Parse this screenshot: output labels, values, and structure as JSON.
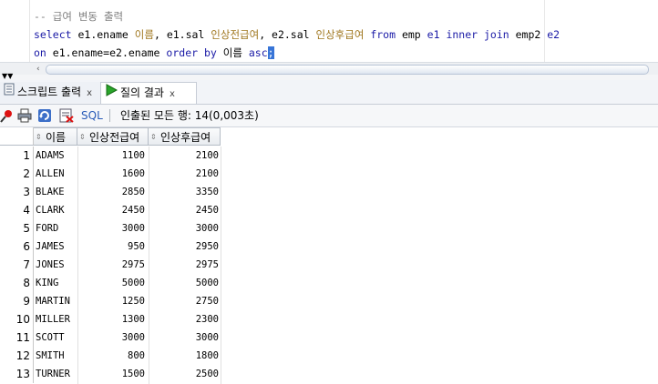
{
  "editor": {
    "lines": [
      {
        "comment": "-- 급여 변동 출력"
      },
      {
        "parts": [
          "select",
          " e1.ename ",
          "이름",
          ", e1.sal ",
          "인상전급여",
          ", e2.sal ",
          "인상후급여",
          " from",
          " emp ",
          "e1",
          " inner",
          " join",
          " emp2 ",
          "e2"
        ]
      },
      {
        "parts": [
          "on",
          " e1.ename=e2.ename ",
          "order",
          " by",
          " 이름 ",
          "asc",
          ";"
        ]
      }
    ]
  },
  "tabs": [
    {
      "label": "스크립트 출력",
      "close": "x",
      "icon": "script-output-icon"
    },
    {
      "label": "질의 결과",
      "close": "x",
      "icon": "run-query-icon"
    }
  ],
  "toolbar": {
    "sql_label": "SQL",
    "status": "인출된 모든 행: 14(0,003초)",
    "icons": [
      "pin-icon",
      "print-icon",
      "refresh-icon",
      "export-icon"
    ]
  },
  "grid": {
    "columns": [
      "이름",
      "인상전급여",
      "인상후급여"
    ],
    "rows": [
      {
        "n": "1",
        "name": "ADAMS",
        "before": "1100",
        "after": "2100"
      },
      {
        "n": "2",
        "name": "ALLEN",
        "before": "1600",
        "after": "2100"
      },
      {
        "n": "3",
        "name": "BLAKE",
        "before": "2850",
        "after": "3350"
      },
      {
        "n": "4",
        "name": "CLARK",
        "before": "2450",
        "after": "2450"
      },
      {
        "n": "5",
        "name": "FORD",
        "before": "3000",
        "after": "3000"
      },
      {
        "n": "6",
        "name": "JAMES",
        "before": "950",
        "after": "2950"
      },
      {
        "n": "7",
        "name": "JONES",
        "before": "2975",
        "after": "2975"
      },
      {
        "n": "8",
        "name": "KING",
        "before": "5000",
        "after": "5000"
      },
      {
        "n": "9",
        "name": "MARTIN",
        "before": "1250",
        "after": "2750"
      },
      {
        "n": "10",
        "name": "MILLER",
        "before": "1300",
        "after": "2300"
      },
      {
        "n": "11",
        "name": "SCOTT",
        "before": "3000",
        "after": "3000"
      },
      {
        "n": "12",
        "name": "SMITH",
        "before": "800",
        "after": "1800"
      },
      {
        "n": "13",
        "name": "TURNER",
        "before": "1500",
        "after": "2500"
      }
    ]
  },
  "colors": {
    "keyword": "#1a1aa6",
    "korean": "#a0771f",
    "comment": "#808080",
    "selection": "#3875d7"
  }
}
